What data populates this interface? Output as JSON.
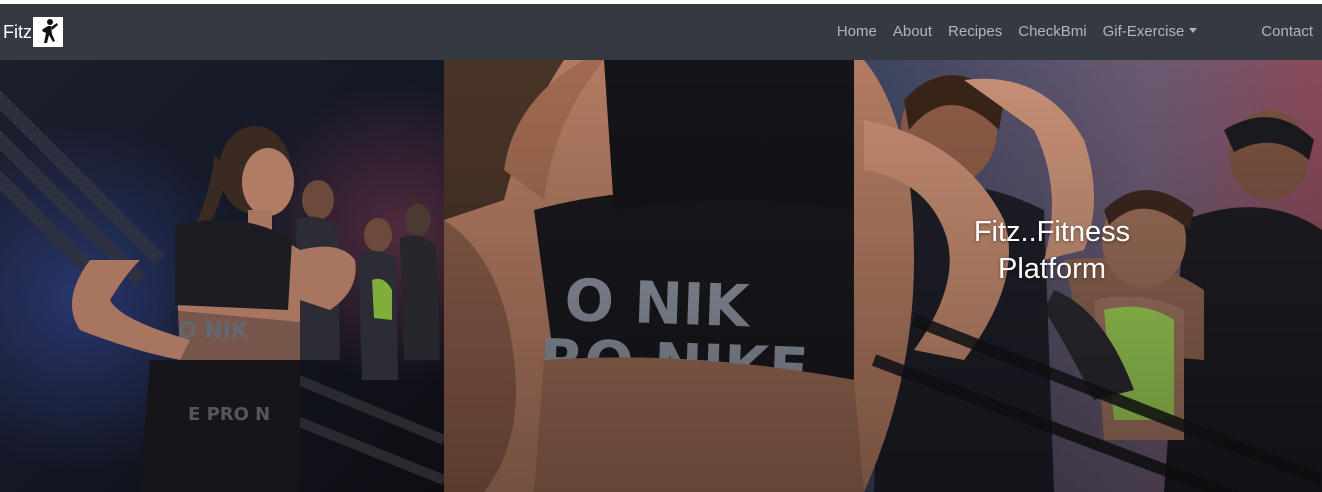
{
  "navbar": {
    "brand": {
      "text": "Fitz",
      "logo_icon": "running-person-icon"
    },
    "links": [
      {
        "label": "Home"
      },
      {
        "label": "About"
      },
      {
        "label": "Recipes"
      },
      {
        "label": "CheckBmi"
      },
      {
        "label": "Gif-Exercise",
        "dropdown": true
      },
      {
        "label": "Contact"
      }
    ]
  },
  "hero": {
    "caption_line1": "Fitz..Fitness",
    "caption_line2": "Platform"
  },
  "colors": {
    "navbar_bg": "#343a40",
    "nav_link": "rgba(255,255,255,0.62)",
    "brand_text": "#ffffff",
    "caption_text": "#ffffff"
  }
}
